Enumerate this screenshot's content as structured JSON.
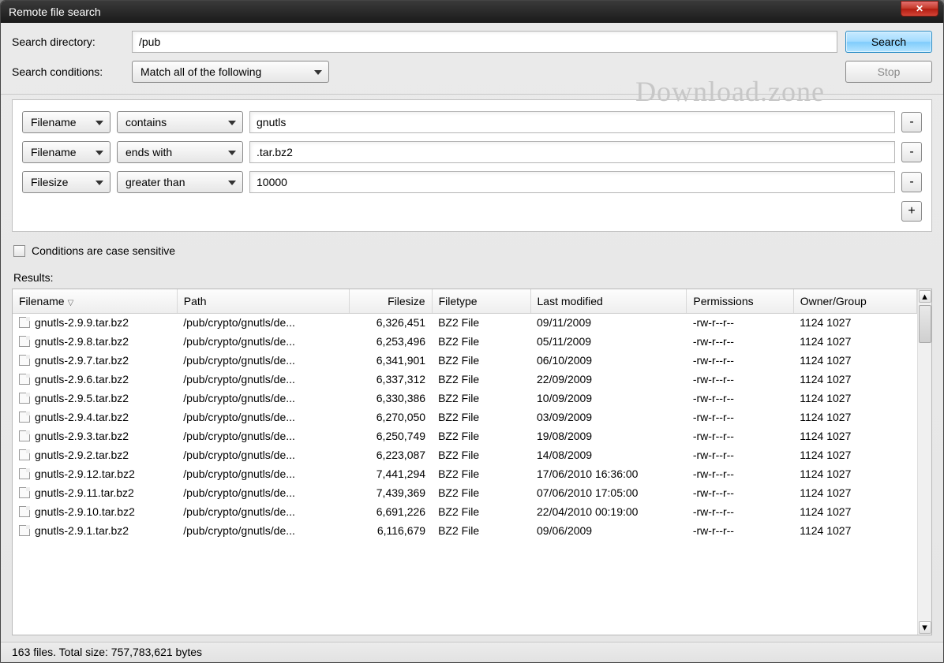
{
  "window": {
    "title": "Remote file search"
  },
  "labels": {
    "search_dir": "Search directory:",
    "search_cond": "Search conditions:",
    "case_sensitive": "Conditions are case sensitive",
    "results": "Results:"
  },
  "buttons": {
    "search": "Search",
    "stop": "Stop",
    "remove": "-",
    "add": "+"
  },
  "search": {
    "directory": "/pub",
    "match_mode": "Match all of the following"
  },
  "conditions": [
    {
      "field": "Filename",
      "op": "contains",
      "value": "gnutls"
    },
    {
      "field": "Filename",
      "op": "ends with",
      "value": ".tar.bz2"
    },
    {
      "field": "Filesize",
      "op": "greater than",
      "value": "10000"
    }
  ],
  "columns": {
    "filename": "Filename",
    "path": "Path",
    "filesize": "Filesize",
    "filetype": "Filetype",
    "last_modified": "Last modified",
    "permissions": "Permissions",
    "owner_group": "Owner/Group"
  },
  "rows": [
    {
      "filename": "gnutls-2.9.9.tar.bz2",
      "path": "/pub/crypto/gnutls/de...",
      "filesize": "6,326,451",
      "filetype": "BZ2 File",
      "last_modified": "09/11/2009",
      "permissions": "-rw-r--r--",
      "owner_group": "1124 1027"
    },
    {
      "filename": "gnutls-2.9.8.tar.bz2",
      "path": "/pub/crypto/gnutls/de...",
      "filesize": "6,253,496",
      "filetype": "BZ2 File",
      "last_modified": "05/11/2009",
      "permissions": "-rw-r--r--",
      "owner_group": "1124 1027"
    },
    {
      "filename": "gnutls-2.9.7.tar.bz2",
      "path": "/pub/crypto/gnutls/de...",
      "filesize": "6,341,901",
      "filetype": "BZ2 File",
      "last_modified": "06/10/2009",
      "permissions": "-rw-r--r--",
      "owner_group": "1124 1027"
    },
    {
      "filename": "gnutls-2.9.6.tar.bz2",
      "path": "/pub/crypto/gnutls/de...",
      "filesize": "6,337,312",
      "filetype": "BZ2 File",
      "last_modified": "22/09/2009",
      "permissions": "-rw-r--r--",
      "owner_group": "1124 1027"
    },
    {
      "filename": "gnutls-2.9.5.tar.bz2",
      "path": "/pub/crypto/gnutls/de...",
      "filesize": "6,330,386",
      "filetype": "BZ2 File",
      "last_modified": "10/09/2009",
      "permissions": "-rw-r--r--",
      "owner_group": "1124 1027"
    },
    {
      "filename": "gnutls-2.9.4.tar.bz2",
      "path": "/pub/crypto/gnutls/de...",
      "filesize": "6,270,050",
      "filetype": "BZ2 File",
      "last_modified": "03/09/2009",
      "permissions": "-rw-r--r--",
      "owner_group": "1124 1027"
    },
    {
      "filename": "gnutls-2.9.3.tar.bz2",
      "path": "/pub/crypto/gnutls/de...",
      "filesize": "6,250,749",
      "filetype": "BZ2 File",
      "last_modified": "19/08/2009",
      "permissions": "-rw-r--r--",
      "owner_group": "1124 1027"
    },
    {
      "filename": "gnutls-2.9.2.tar.bz2",
      "path": "/pub/crypto/gnutls/de...",
      "filesize": "6,223,087",
      "filetype": "BZ2 File",
      "last_modified": "14/08/2009",
      "permissions": "-rw-r--r--",
      "owner_group": "1124 1027"
    },
    {
      "filename": "gnutls-2.9.12.tar.bz2",
      "path": "/pub/crypto/gnutls/de...",
      "filesize": "7,441,294",
      "filetype": "BZ2 File",
      "last_modified": "17/06/2010 16:36:00",
      "permissions": "-rw-r--r--",
      "owner_group": "1124 1027"
    },
    {
      "filename": "gnutls-2.9.11.tar.bz2",
      "path": "/pub/crypto/gnutls/de...",
      "filesize": "7,439,369",
      "filetype": "BZ2 File",
      "last_modified": "07/06/2010 17:05:00",
      "permissions": "-rw-r--r--",
      "owner_group": "1124 1027"
    },
    {
      "filename": "gnutls-2.9.10.tar.bz2",
      "path": "/pub/crypto/gnutls/de...",
      "filesize": "6,691,226",
      "filetype": "BZ2 File",
      "last_modified": "22/04/2010 00:19:00",
      "permissions": "-rw-r--r--",
      "owner_group": "1124 1027"
    },
    {
      "filename": "gnutls-2.9.1.tar.bz2",
      "path": "/pub/crypto/gnutls/de...",
      "filesize": "6,116,679",
      "filetype": "BZ2 File",
      "last_modified": "09/06/2009",
      "permissions": "-rw-r--r--",
      "owner_group": "1124 1027"
    }
  ],
  "status": "163 files. Total size: 757,783,621 bytes",
  "watermark": "Download.zone"
}
